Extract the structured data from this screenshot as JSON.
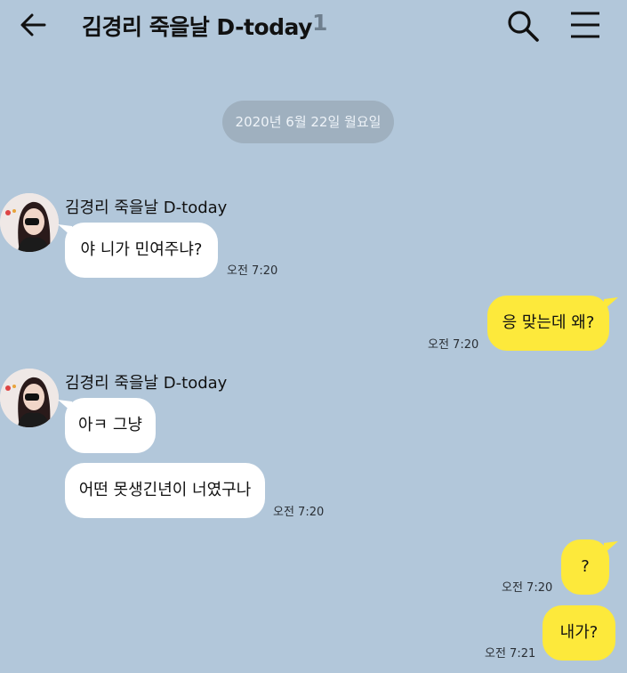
{
  "header": {
    "title": "김경리 죽을날 D-today",
    "member_count": "1"
  },
  "date_divider": "2020년 6월 22일 월요일",
  "messages": [
    {
      "sender": "김경리 죽을날 D-today",
      "text": "야 니가 민여주냐?",
      "time": "오전 7:20"
    },
    {
      "text": "응 맞는데 왜?",
      "time": "오전 7:20"
    },
    {
      "sender": "김경리 죽을날 D-today",
      "text": "아ㅋ 그냥"
    },
    {
      "text": "어떤 못생긴년이 너였구나",
      "time": "오전 7:20"
    },
    {
      "text": "?",
      "time": "오전 7:20"
    },
    {
      "text": "내가?",
      "time": "오전 7:21"
    }
  ],
  "colors": {
    "background": "#b2c7da",
    "incoming_bubble": "#ffffff",
    "outgoing_bubble": "#fde93b",
    "date_pill": "#9fb0bf"
  }
}
